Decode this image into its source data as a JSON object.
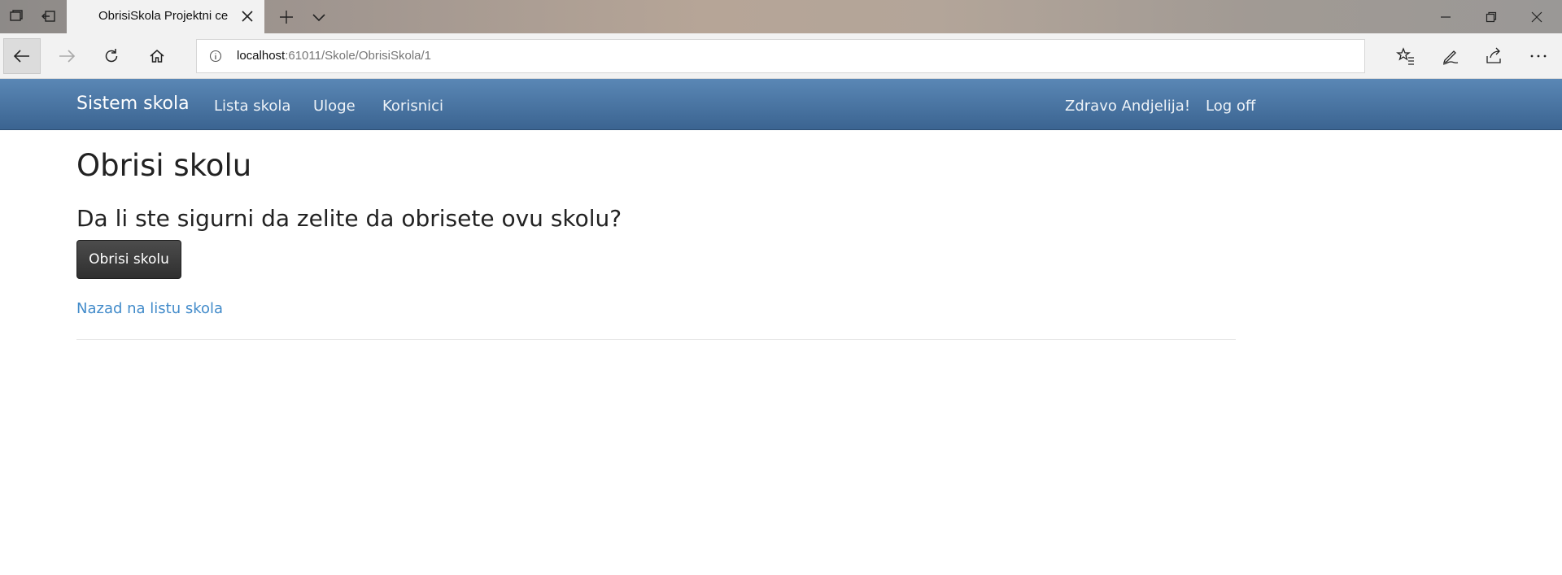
{
  "browser": {
    "tab": {
      "title": "ObrisiSkola Projektni ce"
    },
    "address": {
      "host": "localhost",
      "rest": ":61011/Skole/ObrisiSkola/1"
    }
  },
  "navbar": {
    "brand": "Sistem skola",
    "links": [
      "Lista skola",
      "Uloge",
      "Korisnici"
    ],
    "greeting": "Zdravo Andjelija!",
    "logoff": "Log off"
  },
  "page": {
    "title": "Obrisi skolu",
    "question": "Da li ste sigurni da zelite da obrisete ovu skolu?",
    "delete_button": "Obrisi skolu",
    "back_link": "Nazad na listu skola"
  },
  "colors": {
    "navbar_top": "#5a87b5",
    "navbar_bottom": "#3b6491",
    "link": "#428bca",
    "button": "#3a3a3a"
  }
}
